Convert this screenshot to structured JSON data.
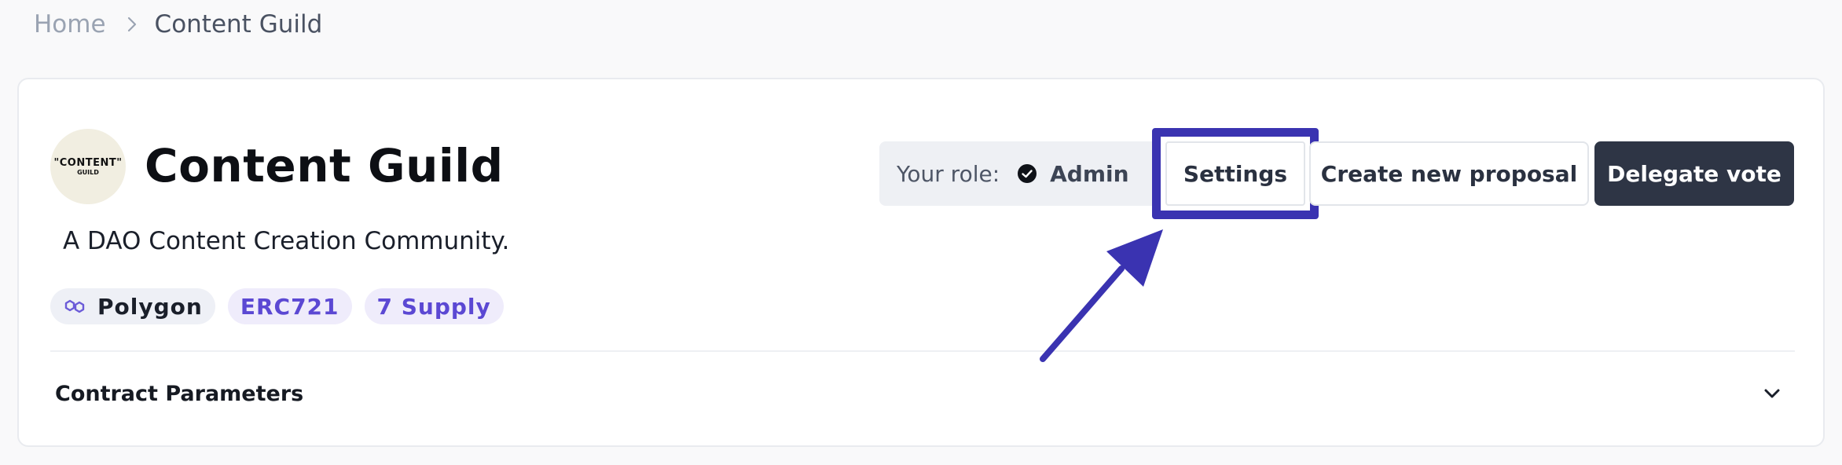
{
  "breadcrumb": {
    "home": "Home",
    "current": "Content Guild"
  },
  "dao": {
    "avatar_text_main": "\"CONTENT\"",
    "avatar_text_sub": "GUILD",
    "name": "Content Guild",
    "description": "A DAO Content Creation Community."
  },
  "tags": {
    "network": "Polygon",
    "standard": "ERC721",
    "supply": "7 Supply"
  },
  "role": {
    "label": "Your role:",
    "value": "Admin"
  },
  "actions": {
    "settings": "Settings",
    "create_proposal": "Create new proposal",
    "delegate_vote": "Delegate vote"
  },
  "accordion": {
    "label": "Contract Parameters"
  },
  "icons": {
    "breadcrumb_separator": "chevron-right-icon",
    "network": "polygon-icon",
    "role_check": "check-circle-icon",
    "accordion_toggle": "chevron-down-icon",
    "annotation": "arrow-icon"
  },
  "colors": {
    "highlight": "#3a33b1",
    "tag_purple_text": "#5b48d3",
    "delegate_bg": "#2e3545"
  }
}
